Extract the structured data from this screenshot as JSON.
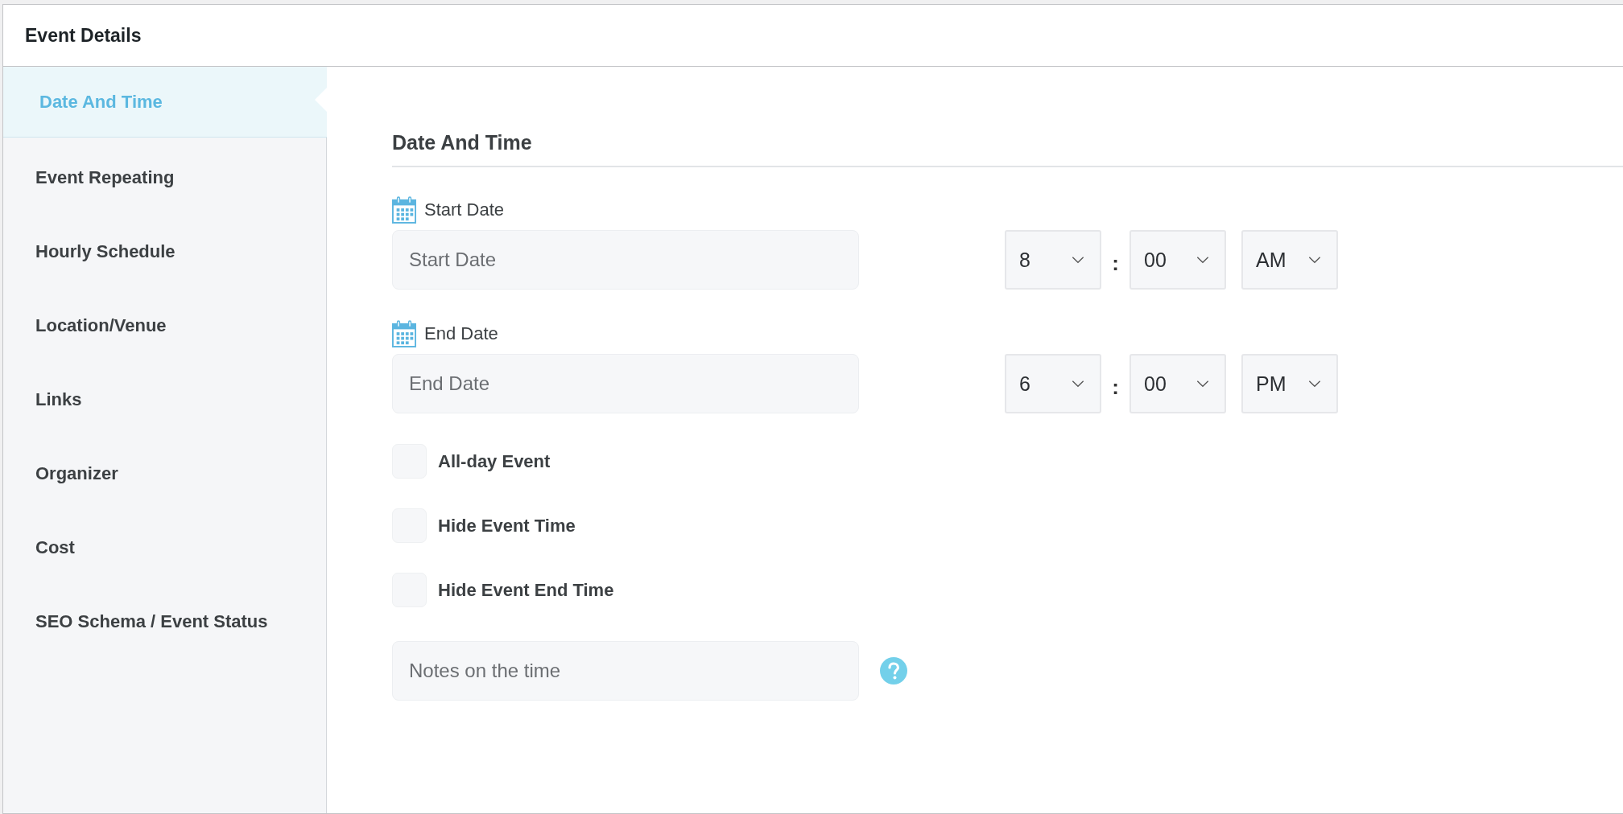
{
  "panel": {
    "title": "Event Details"
  },
  "sidebar": {
    "items": [
      {
        "label": "Date And Time",
        "selected": true
      },
      {
        "label": "Event Repeating",
        "selected": false
      },
      {
        "label": "Hourly Schedule",
        "selected": false
      },
      {
        "label": "Location/Venue",
        "selected": false
      },
      {
        "label": "Links",
        "selected": false
      },
      {
        "label": "Organizer",
        "selected": false
      },
      {
        "label": "Cost",
        "selected": false
      },
      {
        "label": "SEO Schema / Event Status",
        "selected": false
      }
    ]
  },
  "section": {
    "title": "Date And Time",
    "dates": [
      {
        "label": "Start Date",
        "placeholder": "Start Date",
        "hour": "8",
        "separator": ":",
        "minute": "00",
        "meridiem": "AM"
      },
      {
        "label": "End Date",
        "placeholder": "End Date",
        "hour": "6",
        "separator": ":",
        "minute": "00",
        "meridiem": "PM"
      }
    ],
    "options": [
      {
        "label": "All-day Event",
        "checked": false
      },
      {
        "label": "Hide Event Time",
        "checked": false
      },
      {
        "label": "Hide Event End Time",
        "checked": false
      }
    ],
    "notes": {
      "placeholder": "Notes on the time"
    }
  }
}
